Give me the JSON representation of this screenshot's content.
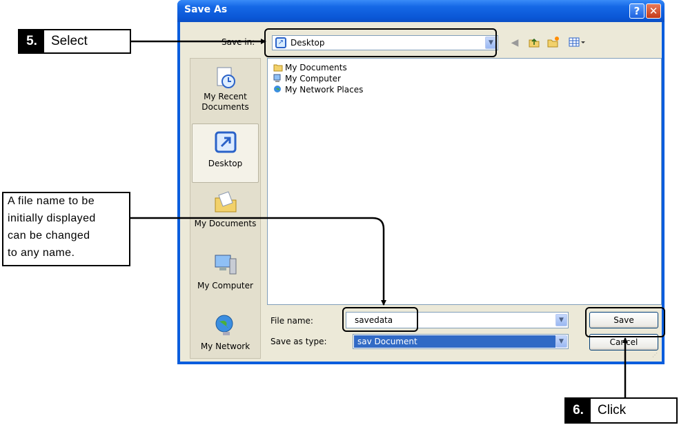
{
  "dialog": {
    "title": "Save As",
    "help_glyph": "?",
    "close_glyph": "✕",
    "save_in_label": "Save in:",
    "location": "Desktop",
    "toolbar_icons": [
      "back-icon",
      "up-folder-icon",
      "new-folder-icon",
      "views-menu-icon"
    ],
    "places": [
      {
        "label": "My Recent Documents",
        "icon": "recent-documents-icon"
      },
      {
        "label": "Desktop",
        "icon": "desktop-icon",
        "selected": true
      },
      {
        "label": "My Documents",
        "icon": "my-documents-icon"
      },
      {
        "label": "My Computer",
        "icon": "my-computer-icon"
      },
      {
        "label": "My Network",
        "icon": "network-icon"
      }
    ],
    "files": [
      {
        "name": "My Documents",
        "icon": "folder-icon"
      },
      {
        "name": "My Computer",
        "icon": "computer-icon"
      },
      {
        "name": "My Network Places",
        "icon": "network-places-icon"
      }
    ],
    "file_name_label": "File name:",
    "file_name_value": "savedata",
    "save_type_label": "Save as type:",
    "save_type_value": "sav Document",
    "save_button": "Save",
    "cancel_button": "Cancel"
  },
  "annotations": {
    "step5": {
      "number": "5.",
      "text": "Select"
    },
    "step6": {
      "number": "6.",
      "text": "Click"
    },
    "note_lines": [
      "A file name to be",
      "initially displayed",
      "can be changed",
      "to any name."
    ]
  },
  "colors": {
    "title_bar": "#0a5ddd",
    "dialog_face": "#ece9d8",
    "selection": "#316ac5"
  }
}
